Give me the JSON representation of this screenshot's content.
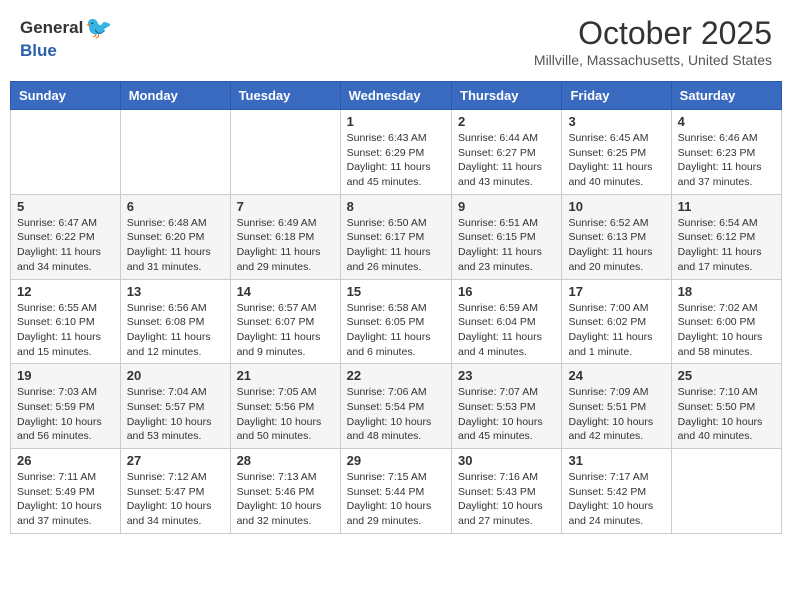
{
  "header": {
    "logo_general": "General",
    "logo_blue": "Blue",
    "month": "October 2025",
    "location": "Millville, Massachusetts, United States"
  },
  "days_of_week": [
    "Sunday",
    "Monday",
    "Tuesday",
    "Wednesday",
    "Thursday",
    "Friday",
    "Saturday"
  ],
  "weeks": [
    [
      {
        "day": "",
        "info": ""
      },
      {
        "day": "",
        "info": ""
      },
      {
        "day": "",
        "info": ""
      },
      {
        "day": "1",
        "info": "Sunrise: 6:43 AM\nSunset: 6:29 PM\nDaylight: 11 hours\nand 45 minutes."
      },
      {
        "day": "2",
        "info": "Sunrise: 6:44 AM\nSunset: 6:27 PM\nDaylight: 11 hours\nand 43 minutes."
      },
      {
        "day": "3",
        "info": "Sunrise: 6:45 AM\nSunset: 6:25 PM\nDaylight: 11 hours\nand 40 minutes."
      },
      {
        "day": "4",
        "info": "Sunrise: 6:46 AM\nSunset: 6:23 PM\nDaylight: 11 hours\nand 37 minutes."
      }
    ],
    [
      {
        "day": "5",
        "info": "Sunrise: 6:47 AM\nSunset: 6:22 PM\nDaylight: 11 hours\nand 34 minutes."
      },
      {
        "day": "6",
        "info": "Sunrise: 6:48 AM\nSunset: 6:20 PM\nDaylight: 11 hours\nand 31 minutes."
      },
      {
        "day": "7",
        "info": "Sunrise: 6:49 AM\nSunset: 6:18 PM\nDaylight: 11 hours\nand 29 minutes."
      },
      {
        "day": "8",
        "info": "Sunrise: 6:50 AM\nSunset: 6:17 PM\nDaylight: 11 hours\nand 26 minutes."
      },
      {
        "day": "9",
        "info": "Sunrise: 6:51 AM\nSunset: 6:15 PM\nDaylight: 11 hours\nand 23 minutes."
      },
      {
        "day": "10",
        "info": "Sunrise: 6:52 AM\nSunset: 6:13 PM\nDaylight: 11 hours\nand 20 minutes."
      },
      {
        "day": "11",
        "info": "Sunrise: 6:54 AM\nSunset: 6:12 PM\nDaylight: 11 hours\nand 17 minutes."
      }
    ],
    [
      {
        "day": "12",
        "info": "Sunrise: 6:55 AM\nSunset: 6:10 PM\nDaylight: 11 hours\nand 15 minutes."
      },
      {
        "day": "13",
        "info": "Sunrise: 6:56 AM\nSunset: 6:08 PM\nDaylight: 11 hours\nand 12 minutes."
      },
      {
        "day": "14",
        "info": "Sunrise: 6:57 AM\nSunset: 6:07 PM\nDaylight: 11 hours\nand 9 minutes."
      },
      {
        "day": "15",
        "info": "Sunrise: 6:58 AM\nSunset: 6:05 PM\nDaylight: 11 hours\nand 6 minutes."
      },
      {
        "day": "16",
        "info": "Sunrise: 6:59 AM\nSunset: 6:04 PM\nDaylight: 11 hours\nand 4 minutes."
      },
      {
        "day": "17",
        "info": "Sunrise: 7:00 AM\nSunset: 6:02 PM\nDaylight: 11 hours\nand 1 minute."
      },
      {
        "day": "18",
        "info": "Sunrise: 7:02 AM\nSunset: 6:00 PM\nDaylight: 10 hours\nand 58 minutes."
      }
    ],
    [
      {
        "day": "19",
        "info": "Sunrise: 7:03 AM\nSunset: 5:59 PM\nDaylight: 10 hours\nand 56 minutes."
      },
      {
        "day": "20",
        "info": "Sunrise: 7:04 AM\nSunset: 5:57 PM\nDaylight: 10 hours\nand 53 minutes."
      },
      {
        "day": "21",
        "info": "Sunrise: 7:05 AM\nSunset: 5:56 PM\nDaylight: 10 hours\nand 50 minutes."
      },
      {
        "day": "22",
        "info": "Sunrise: 7:06 AM\nSunset: 5:54 PM\nDaylight: 10 hours\nand 48 minutes."
      },
      {
        "day": "23",
        "info": "Sunrise: 7:07 AM\nSunset: 5:53 PM\nDaylight: 10 hours\nand 45 minutes."
      },
      {
        "day": "24",
        "info": "Sunrise: 7:09 AM\nSunset: 5:51 PM\nDaylight: 10 hours\nand 42 minutes."
      },
      {
        "day": "25",
        "info": "Sunrise: 7:10 AM\nSunset: 5:50 PM\nDaylight: 10 hours\nand 40 minutes."
      }
    ],
    [
      {
        "day": "26",
        "info": "Sunrise: 7:11 AM\nSunset: 5:49 PM\nDaylight: 10 hours\nand 37 minutes."
      },
      {
        "day": "27",
        "info": "Sunrise: 7:12 AM\nSunset: 5:47 PM\nDaylight: 10 hours\nand 34 minutes."
      },
      {
        "day": "28",
        "info": "Sunrise: 7:13 AM\nSunset: 5:46 PM\nDaylight: 10 hours\nand 32 minutes."
      },
      {
        "day": "29",
        "info": "Sunrise: 7:15 AM\nSunset: 5:44 PM\nDaylight: 10 hours\nand 29 minutes."
      },
      {
        "day": "30",
        "info": "Sunrise: 7:16 AM\nSunset: 5:43 PM\nDaylight: 10 hours\nand 27 minutes."
      },
      {
        "day": "31",
        "info": "Sunrise: 7:17 AM\nSunset: 5:42 PM\nDaylight: 10 hours\nand 24 minutes."
      },
      {
        "day": "",
        "info": ""
      }
    ]
  ]
}
